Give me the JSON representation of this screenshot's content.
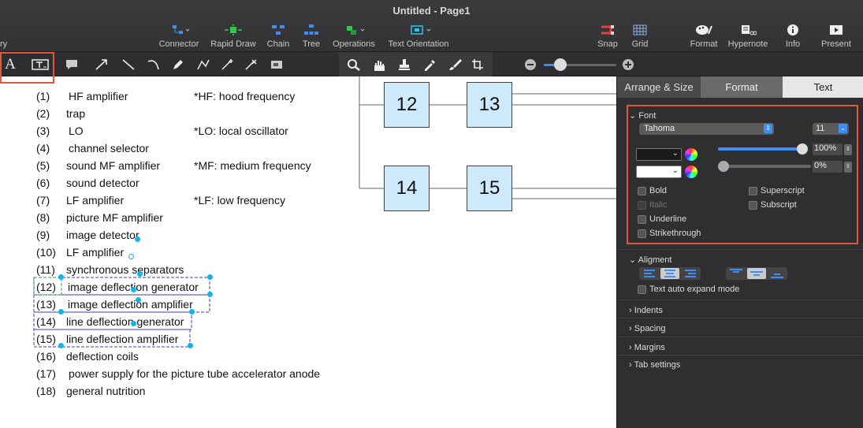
{
  "window": {
    "title": "Untitled - Page1",
    "left_cut_label": "ry"
  },
  "toolbar": {
    "connector": "Connector",
    "rapid_draw": "Rapid Draw",
    "chain": "Chain",
    "tree": "Tree",
    "operations": "Operations",
    "text_orientation": "Text Orientation",
    "snap": "Snap",
    "grid": "Grid",
    "format": "Format",
    "hypernote": "Hypernote",
    "info": "Info",
    "present": "Present"
  },
  "list": [
    {
      "num": "(1)",
      "text": "HF amplifier"
    },
    {
      "num": "(2)",
      "text": "trap"
    },
    {
      "num": "(3)",
      "text": "LO"
    },
    {
      "num": "(4)",
      "text": "channel selector"
    },
    {
      "num": "(5)",
      "text": "sound MF amplifier"
    },
    {
      "num": "(6)",
      "text": "sound detector"
    },
    {
      "num": "(7)",
      "text": "LF amplifier"
    },
    {
      "num": "(8)",
      "text": "picture MF amplifier"
    },
    {
      "num": "(9)",
      "text": "image detector"
    },
    {
      "num": "(10)",
      "text": "LF amplifier"
    },
    {
      "num": "(11)",
      "text": "synchronous separators"
    },
    {
      "num": "(12)",
      "text": "image deflection generator"
    },
    {
      "num": "(13)",
      "text": "image deflection amplifier"
    },
    {
      "num": "(14)",
      "text": "line deflection generator"
    },
    {
      "num": "(15)",
      "text": "line deflection amplifier"
    },
    {
      "num": "(16)",
      "text": "deflection coils"
    },
    {
      "num": "(17)",
      "text": "power supply for the picture tube accelerator anode"
    },
    {
      "num": "(18)",
      "text": "general nutrition"
    }
  ],
  "notes": [
    "*HF: hood frequency",
    "*LO: local oscillator",
    "*MF: medium frequency",
    "*LF: low frequency"
  ],
  "boxes": [
    "12",
    "13",
    "14",
    "15"
  ],
  "panel": {
    "tabs": [
      "Arrange & Size",
      "Format",
      "Text"
    ],
    "font_section": "Font",
    "font_name": "Tahoma",
    "font_size": "11",
    "opacity1": "100%",
    "opacity2": "0%",
    "bold": "Bold",
    "italic": "Italic",
    "underline": "Underline",
    "strikethrough": "Strikethrough",
    "superscript": "Superscript",
    "subscript": "Subscript",
    "alignment": "Aligment",
    "auto_expand": "Text auto expand mode",
    "indents": "Indents",
    "spacing": "Spacing",
    "margins": "Margins",
    "tab_settings": "Tab settings"
  },
  "colors": {
    "accent": "#e0593a",
    "box_fill": "#cde9fb",
    "selection": "#12b4e6",
    "slider": "#2f7ff0"
  }
}
